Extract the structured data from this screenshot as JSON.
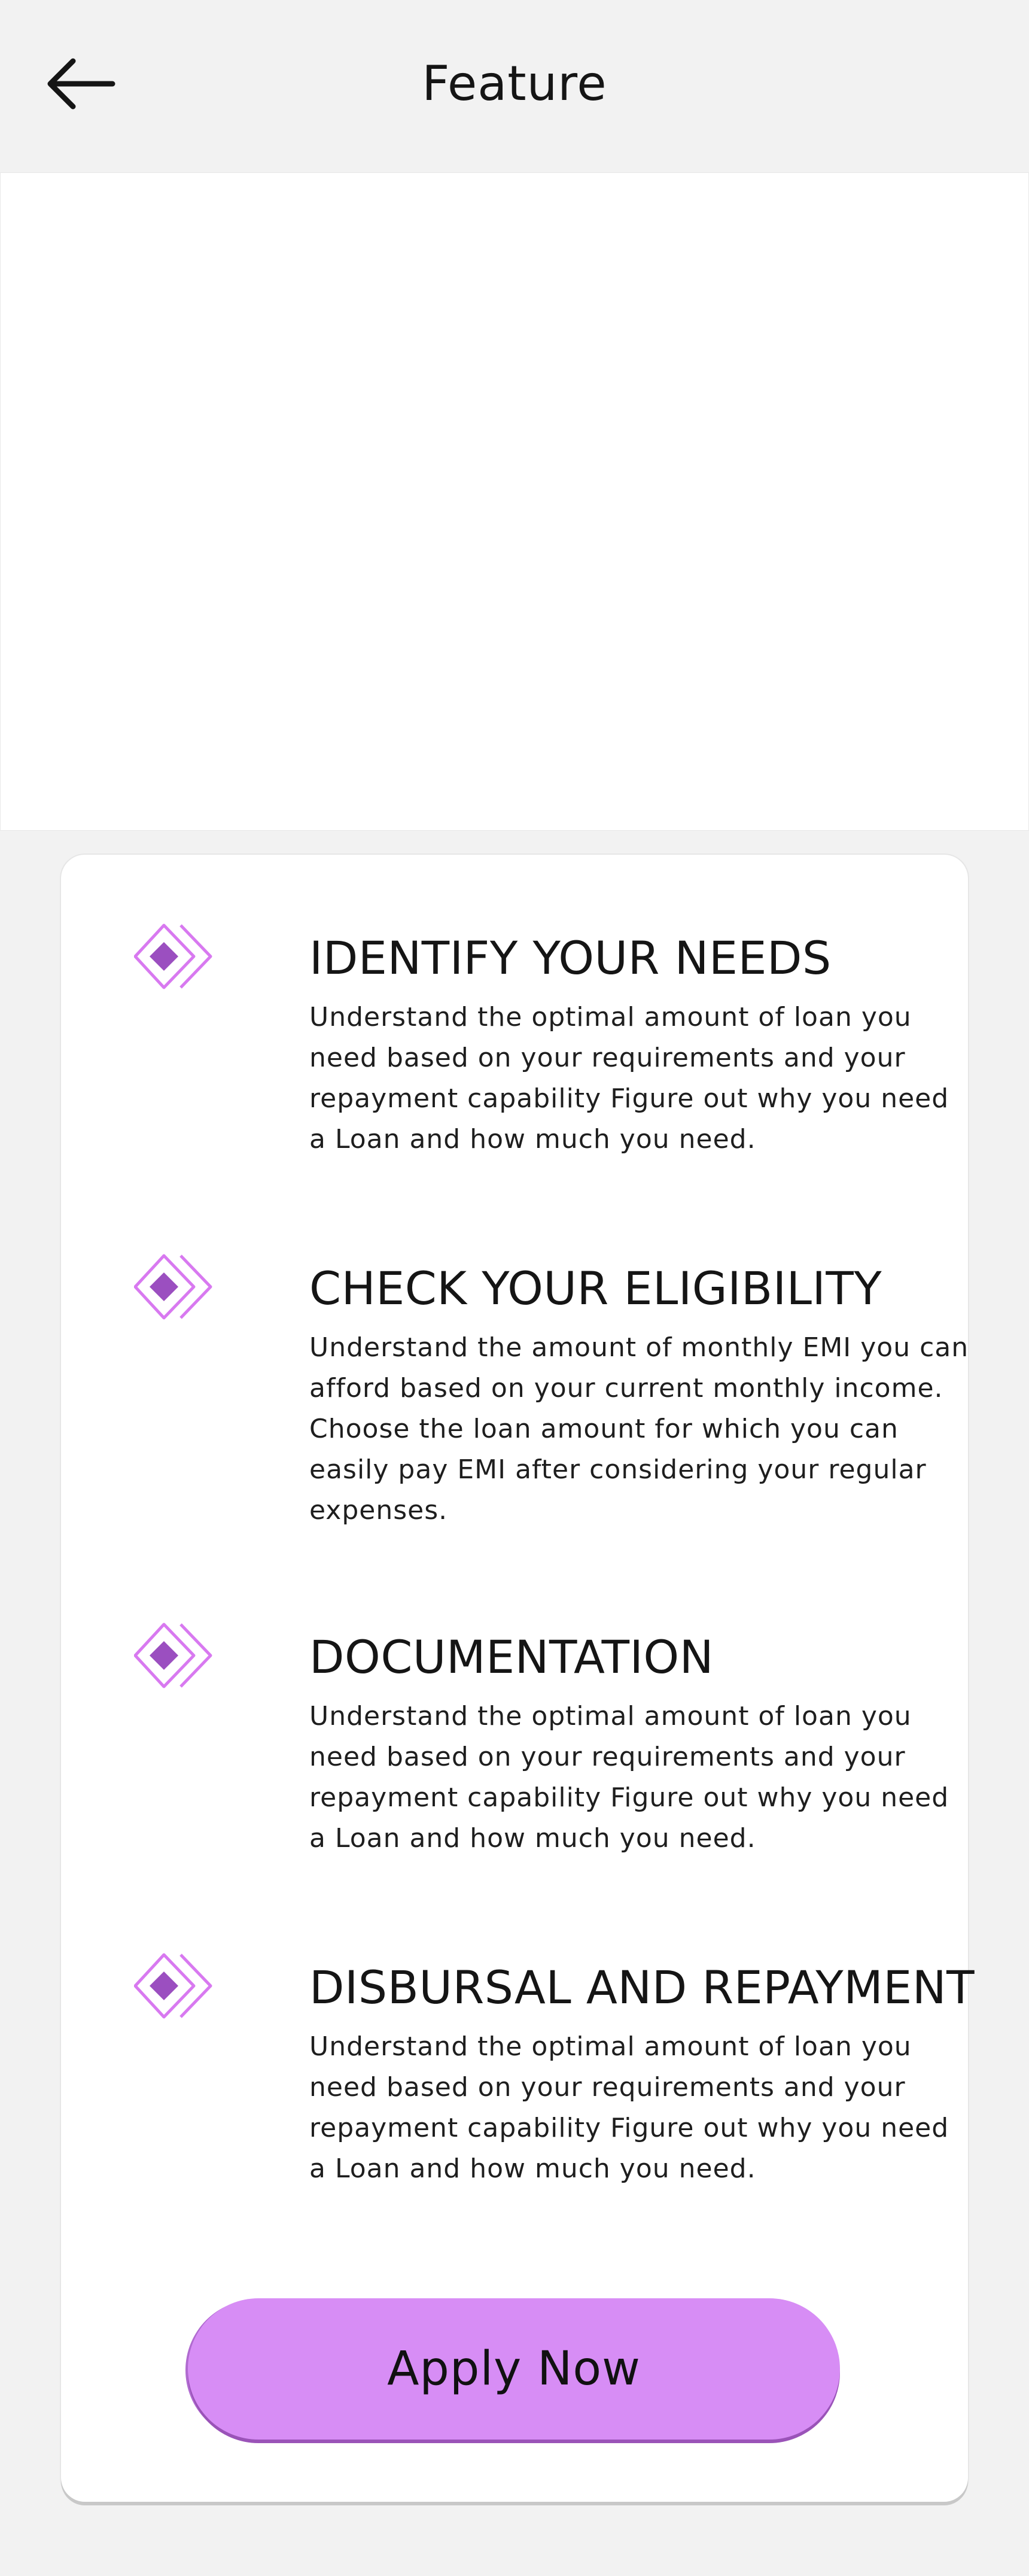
{
  "header": {
    "title": "Feature",
    "back_icon": "arrow-left-icon"
  },
  "colors": {
    "accent": "#d78df5",
    "icon_fill": "#9b4fc0",
    "icon_stroke": "#d879f0",
    "background": "#f2f2f2"
  },
  "features": [
    {
      "icon": "diamond-arrow-icon",
      "title": "IDENTIFY YOUR NEEDS",
      "description": "Understand the optimal amount of loan you need based on your requirements and your repayment capability Figure out why you need a Loan and how much you need."
    },
    {
      "icon": "diamond-arrow-icon",
      "title": "CHECK YOUR ELIGIBILITY",
      "description": "Understand the amount of monthly EMI you can afford based on your current monthly income. Choose the loan amount for which you can easily pay EMI after considering your regular expenses."
    },
    {
      "icon": "diamond-arrow-icon",
      "title": "DOCUMENTATION",
      "description": "Understand the optimal amount of loan you need based on your requirements and your repayment capability Figure out why you need a Loan and how much you need."
    },
    {
      "icon": "diamond-arrow-icon",
      "title": "DISBURSAL AND REPAYMENT",
      "description": "Understand the optimal amount of loan you need based on your requirements and your repayment capability Figure out why you need a Loan and how much you need."
    }
  ],
  "apply_button": {
    "label": "Apply Now"
  }
}
